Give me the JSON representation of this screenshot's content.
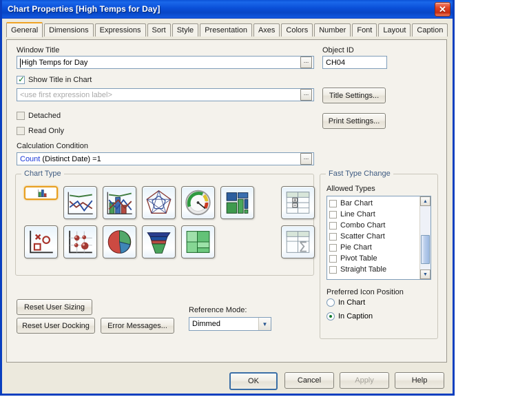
{
  "window": {
    "title": "Chart Properties [High Temps for Day]",
    "close_icon": "close-icon"
  },
  "tabs": [
    {
      "label": "General",
      "active": true
    },
    {
      "label": "Dimensions",
      "active": false
    },
    {
      "label": "Expressions",
      "active": false
    },
    {
      "label": "Sort",
      "active": false
    },
    {
      "label": "Style",
      "active": false
    },
    {
      "label": "Presentation",
      "active": false
    },
    {
      "label": "Axes",
      "active": false
    },
    {
      "label": "Colors",
      "active": false
    },
    {
      "label": "Number",
      "active": false
    },
    {
      "label": "Font",
      "active": false
    },
    {
      "label": "Layout",
      "active": false
    },
    {
      "label": "Caption",
      "active": false
    }
  ],
  "general": {
    "window_title_label": "Window Title",
    "window_title_value": "High Temps for Day",
    "object_id_label": "Object ID",
    "object_id_value": "CH04",
    "show_title_label": "Show Title in Chart",
    "show_title_checked": true,
    "chart_title_placeholder": "<use first expression label>",
    "title_settings_label": "Title Settings...",
    "print_settings_label": "Print Settings...",
    "detached_label": "Detached",
    "detached_checked": false,
    "read_only_label": "Read Only",
    "read_only_checked": false,
    "calc_condition_label": "Calculation Condition",
    "calc_condition_keyword": "Count",
    "calc_condition_rest": " (Distinct Date) =1",
    "ellipsis_label": "..."
  },
  "chart_type": {
    "caption": "Chart Type",
    "icons": [
      {
        "name": "bar-chart-icon",
        "label": "Bar Chart",
        "selected": true
      },
      {
        "name": "line-chart-icon",
        "label": "Line Chart",
        "selected": false
      },
      {
        "name": "combo-chart-icon",
        "label": "Combo Chart",
        "selected": false
      },
      {
        "name": "radar-chart-icon",
        "label": "Radar Chart",
        "selected": false
      },
      {
        "name": "gauge-chart-icon",
        "label": "Gauge Chart",
        "selected": false
      },
      {
        "name": "block-chart-icon",
        "label": "Block Chart",
        "selected": false
      },
      {
        "name": "pivot-table-icon",
        "label": "Pivot Table",
        "selected": false
      },
      {
        "name": "scatter-chart-icon",
        "label": "Scatter Chart",
        "selected": false
      },
      {
        "name": "grid-chart-icon",
        "label": "Grid Chart",
        "selected": false
      },
      {
        "name": "pie-chart-icon",
        "label": "Pie Chart",
        "selected": false
      },
      {
        "name": "funnel-chart-icon",
        "label": "Funnel Chart",
        "selected": false
      },
      {
        "name": "mekko-chart-icon",
        "label": "Mekko Chart",
        "selected": false
      },
      {
        "name": "straight-table-icon",
        "label": "Straight Table",
        "selected": false
      }
    ]
  },
  "fast_type_change": {
    "caption": "Fast Type Change",
    "allowed_types_label": "Allowed Types",
    "allowed_types": [
      {
        "label": "Bar Chart",
        "checked": false
      },
      {
        "label": "Line Chart",
        "checked": false
      },
      {
        "label": "Combo Chart",
        "checked": false
      },
      {
        "label": "Scatter Chart",
        "checked": false
      },
      {
        "label": "Pie Chart",
        "checked": false
      },
      {
        "label": "Pivot Table",
        "checked": false
      },
      {
        "label": "Straight Table",
        "checked": false
      }
    ],
    "scroll_up_icon": "chevron-up-icon",
    "scroll_down_icon": "chevron-down-icon",
    "icon_position_label": "Preferred Icon Position",
    "icon_position_options": [
      {
        "label": "In Chart",
        "selected": false
      },
      {
        "label": "In Caption",
        "selected": true
      }
    ]
  },
  "bottom": {
    "reset_user_sizing_label": "Reset User Sizing",
    "reset_user_docking_label": "Reset User Docking",
    "error_messages_label": "Error Messages...",
    "reference_mode_label": "Reference Mode:",
    "reference_mode_value": "Dimmed",
    "reference_mode_arrow": "chevron-down-icon"
  },
  "dialog_buttons": [
    {
      "label": "OK",
      "default": true,
      "disabled": false
    },
    {
      "label": "Cancel",
      "default": false,
      "disabled": false
    },
    {
      "label": "Apply",
      "default": false,
      "disabled": true
    },
    {
      "label": "Help",
      "default": false,
      "disabled": false
    }
  ]
}
